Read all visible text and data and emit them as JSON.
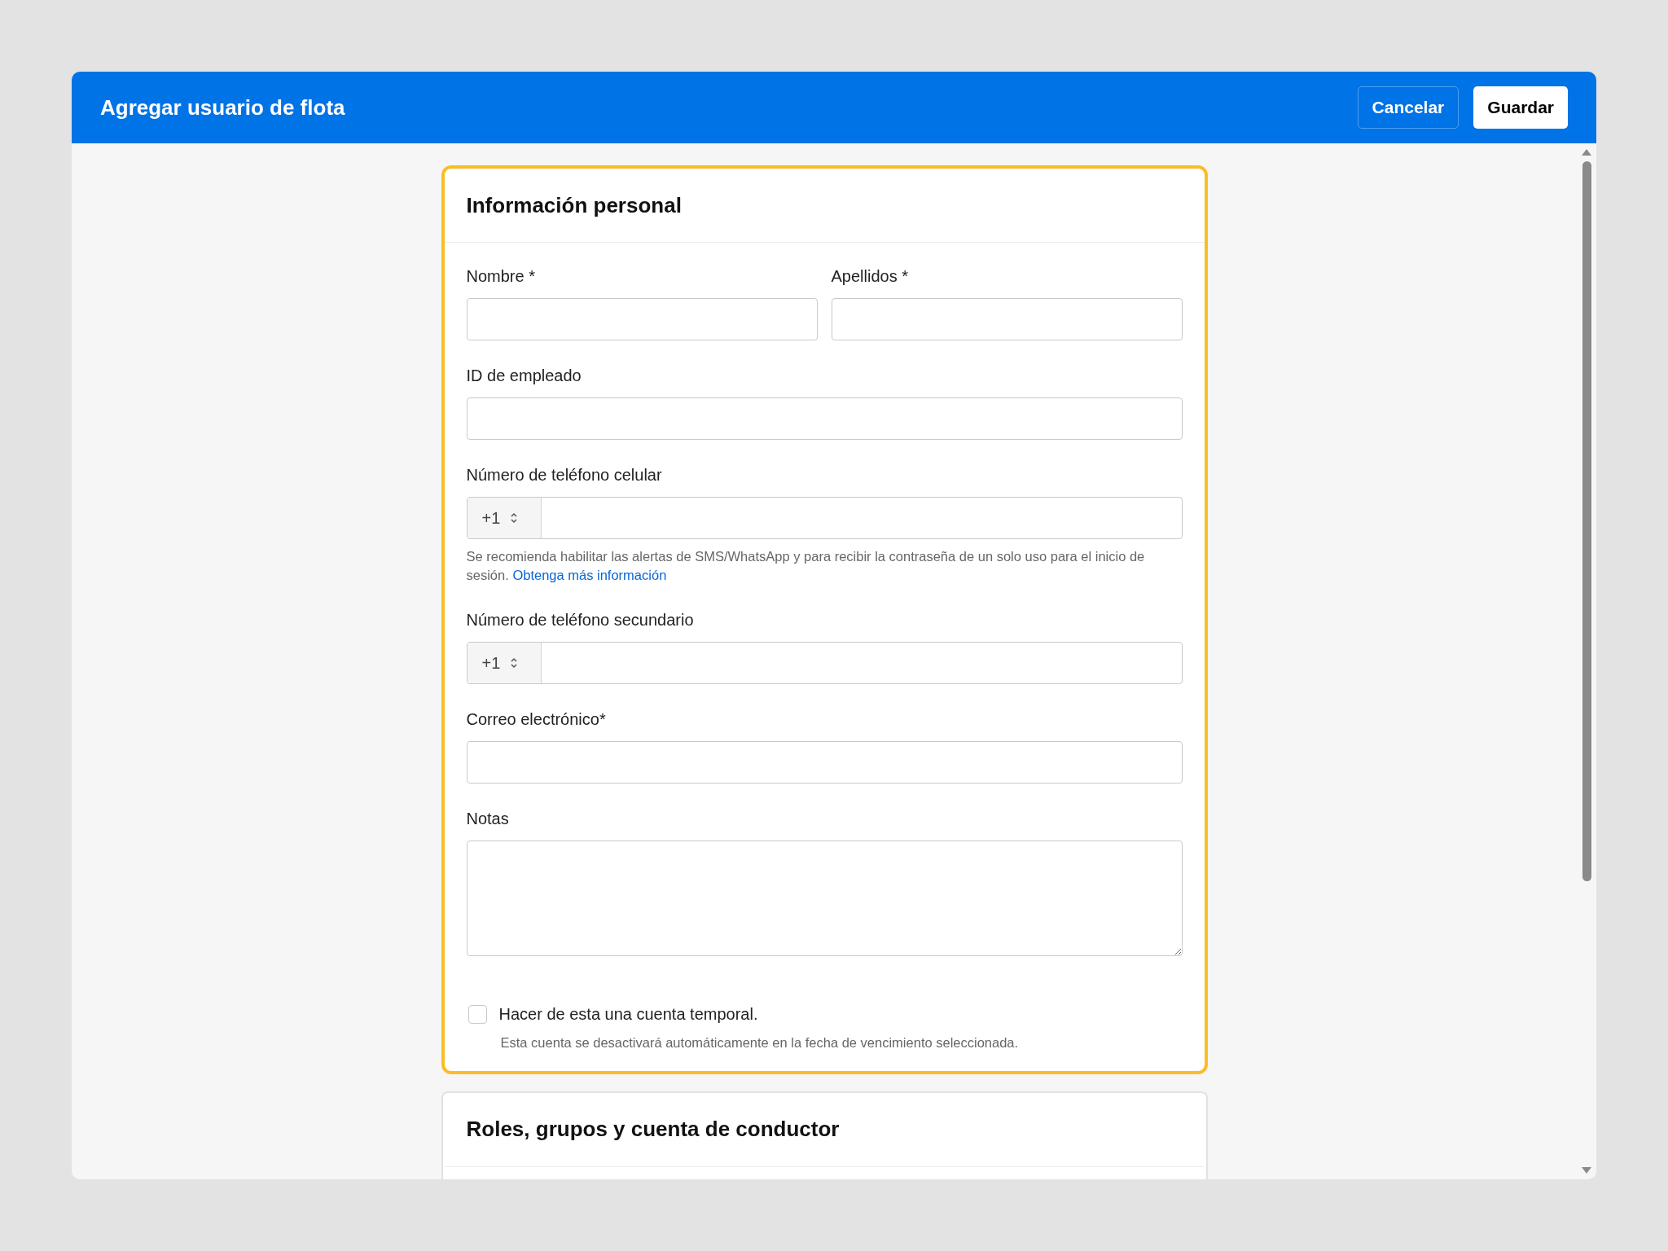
{
  "header": {
    "title": "Agregar usuario de flota",
    "buttons": [
      {
        "label": "Cancelar",
        "kind": "secondary"
      },
      {
        "label": "Guardar",
        "kind": "primary"
      }
    ]
  },
  "sections": [
    {
      "title": "Información personal",
      "highlighted": true,
      "rows": [
        {
          "fields": [
            {
              "kind": "text",
              "label": "Nombre *"
            },
            {
              "kind": "text",
              "label": "Apellidos *"
            }
          ]
        },
        {
          "fields": [
            {
              "kind": "text",
              "label": "ID de empleado"
            }
          ]
        },
        {
          "fields": [
            {
              "kind": "phone",
              "label": "Número de teléfono celular",
              "country_code": "+1",
              "help": "Se recomienda habilitar las alertas de SMS/WhatsApp y para recibir la contraseña de un solo uso para el inicio de sesión.",
              "help_link": "Obtenga más información"
            }
          ]
        },
        {
          "fields": [
            {
              "kind": "phone",
              "label": "Número de teléfono secundario",
              "country_code": "+1"
            }
          ]
        },
        {
          "fields": [
            {
              "kind": "text",
              "label": "Correo electrónico*"
            }
          ]
        },
        {
          "fields": [
            {
              "kind": "textarea",
              "label": "Notas"
            }
          ]
        }
      ],
      "checkbox": {
        "label": "Hacer de esta una cuenta temporal.",
        "checked": false,
        "help": "Esta cuenta se desactivará automáticamente en la fecha de vencimiento seleccionada."
      }
    },
    {
      "title": "Roles, grupos y cuenta de conductor",
      "highlighted": false
    }
  ]
}
